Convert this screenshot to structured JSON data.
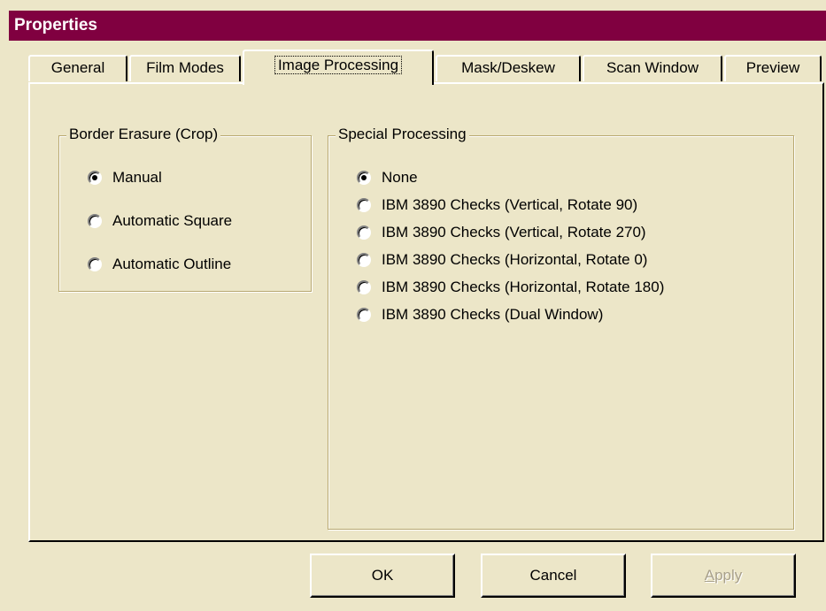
{
  "window": {
    "title": "Properties"
  },
  "tabs": [
    {
      "label": "General",
      "active": false
    },
    {
      "label": "Film Modes",
      "active": false
    },
    {
      "label": "Image Processing",
      "active": true
    },
    {
      "label": "Mask/Deskew",
      "active": false
    },
    {
      "label": "Scan Window",
      "active": false
    },
    {
      "label": "Preview",
      "active": false
    }
  ],
  "border_erasure": {
    "title": "Border Erasure (Crop)",
    "options": [
      {
        "label": "Manual",
        "checked": true
      },
      {
        "label": "Automatic Square",
        "checked": false
      },
      {
        "label": "Automatic Outline",
        "checked": false
      }
    ]
  },
  "special_processing": {
    "title": "Special Processing",
    "options": [
      {
        "label": "None",
        "checked": true
      },
      {
        "label": "IBM 3890 Checks (Vertical, Rotate 90)",
        "checked": false
      },
      {
        "label": "IBM 3890 Checks (Vertical, Rotate 270)",
        "checked": false
      },
      {
        "label": "IBM 3890 Checks (Horizontal, Rotate 0)",
        "checked": false
      },
      {
        "label": "IBM 3890 Checks (Horizontal, Rotate 180)",
        "checked": false
      },
      {
        "label": "IBM 3890 Checks (Dual Window)",
        "checked": false
      }
    ]
  },
  "buttons": {
    "ok": "OK",
    "cancel": "Cancel",
    "apply_mnemonic": "A",
    "apply_rest": "pply",
    "apply_enabled": false
  },
  "colors": {
    "titlebar": "#800040",
    "face": "#ece6c8",
    "disabled_text": "#a8a08a"
  }
}
